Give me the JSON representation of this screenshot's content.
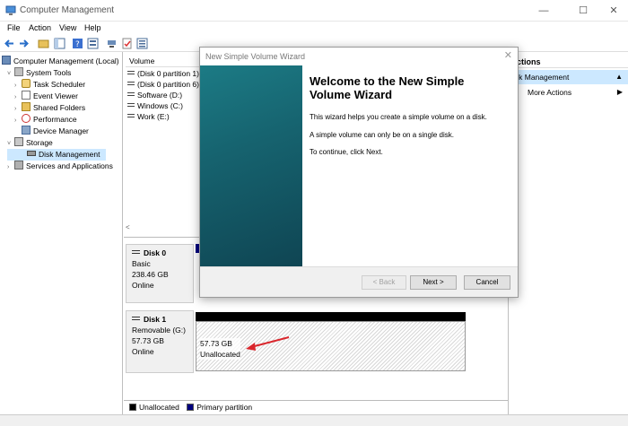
{
  "window": {
    "title": "Computer Management",
    "controls": {
      "minimize": "—",
      "maximize": "☐",
      "close": "✕"
    }
  },
  "menu": [
    "File",
    "Action",
    "View",
    "Help"
  ],
  "tree": {
    "root": "Computer Management (Local)",
    "system_tools": "System Tools",
    "task_scheduler": "Task Scheduler",
    "event_viewer": "Event Viewer",
    "shared_folders": "Shared Folders",
    "performance": "Performance",
    "device_manager": "Device Manager",
    "storage": "Storage",
    "disk_management": "Disk Management",
    "services": "Services and Applications"
  },
  "volumes": {
    "header": "Volume",
    "rows": [
      "(Disk 0 partition 1)",
      "(Disk 0 partition 6)",
      "Software (D:)",
      "Windows (C:)",
      "Work (E:)"
    ],
    "scroll_left": "<"
  },
  "disks": {
    "disk0": {
      "name": "Disk 0",
      "type": "Basic",
      "size": "238.46 GB",
      "status": "Online"
    },
    "disk1": {
      "name": "Disk 1",
      "type": "Removable (G:)",
      "size": "57.73 GB",
      "status": "Online",
      "part_size": "57.73 GB",
      "part_state": "Unallocated"
    }
  },
  "legend": {
    "unallocated": "Unallocated",
    "primary": "Primary partition"
  },
  "actions": {
    "header": "ctions",
    "selected": "isk Management",
    "selected_arrow": "▲",
    "more": "More Actions",
    "more_arrow": "▶"
  },
  "wizard": {
    "title": "New Simple Volume Wizard",
    "close": "✕",
    "heading": "Welcome to the New Simple Volume Wizard",
    "p1": "This wizard helps you create a simple volume on a disk.",
    "p2": "A simple volume can only be on a single disk.",
    "p3": "To continue, click Next.",
    "back": "< Back",
    "next": "Next >",
    "cancel": "Cancel"
  },
  "colors": {
    "primary_partition": "#00007f",
    "unallocated": "#000000",
    "selection": "#cce8ff",
    "arrow": "#d9262c"
  }
}
